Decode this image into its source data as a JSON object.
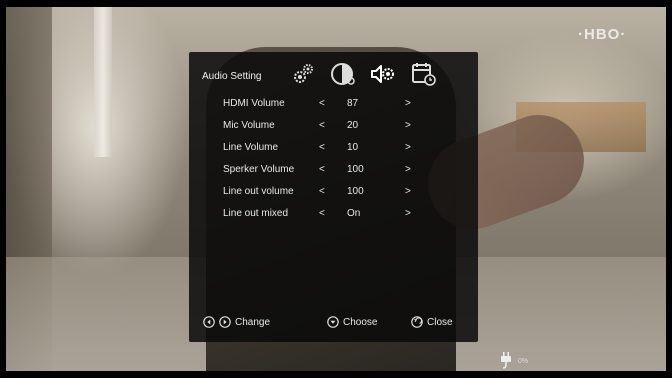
{
  "channel_logo": "·HBO·",
  "menu": {
    "title": "Audio Setting",
    "tabs": [
      {
        "icon": "gears-icon"
      },
      {
        "icon": "display-icon"
      },
      {
        "icon": "speaker-settings-icon",
        "selected": true
      },
      {
        "icon": "calendar-clock-icon"
      }
    ],
    "rows": [
      {
        "label": "HDMI Volume",
        "left_arrow": "<",
        "value": "87",
        "right_arrow": ">"
      },
      {
        "label": "Mic Volume",
        "left_arrow": "<",
        "value": "20",
        "right_arrow": ">"
      },
      {
        "label": "Line Volume",
        "left_arrow": "<",
        "value": "10",
        "right_arrow": ">"
      },
      {
        "label": "Sperker Volume",
        "left_arrow": "<",
        "value": "100",
        "right_arrow": ">"
      },
      {
        "label": "Line out volume",
        "left_arrow": "<",
        "value": "100",
        "right_arrow": ">"
      },
      {
        "label": "Line out mixed",
        "left_arrow": "<",
        "value": "On",
        "right_arrow": ">"
      }
    ],
    "hints": {
      "change": "Change",
      "choose": "Choose",
      "close": "Close"
    }
  },
  "status": {
    "power_percent": "0%"
  },
  "colors": {
    "panel_bg": "#0a0a0a",
    "text": "#e8e8e8",
    "selected_tab": "#ffffff"
  }
}
